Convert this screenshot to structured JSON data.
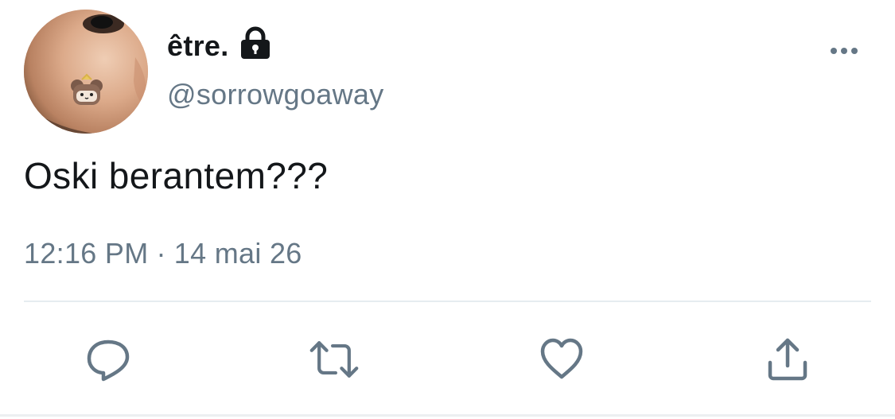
{
  "tweet": {
    "display_name": "être.",
    "username": "@sorrowgoaway",
    "text": "Oski berantem???",
    "time": "12:16 PM",
    "separator": "·",
    "date": "14 mai 26",
    "protected": true
  },
  "icons": {
    "lock": "lock-icon",
    "more": "more-options-icon",
    "reply": "reply-icon",
    "retweet": "retweet-icon",
    "like": "heart-icon",
    "share": "share-icon"
  },
  "colors": {
    "primary_text": "#14171a",
    "secondary_text": "#657786",
    "icon": "#657786",
    "divider": "#e6ecf0"
  }
}
